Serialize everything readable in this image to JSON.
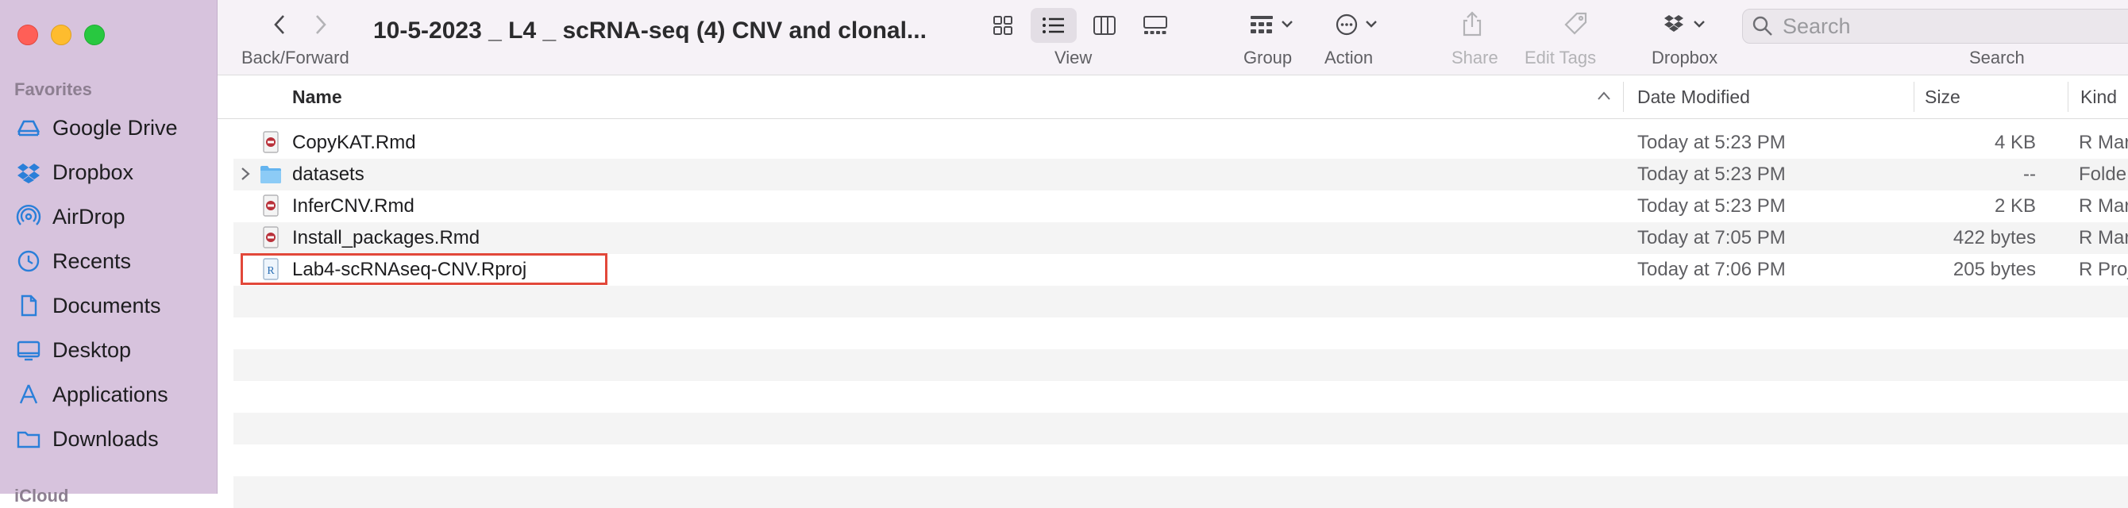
{
  "window": {
    "title": "10-5-2023 _ L4 _ scRNA-seq (4) CNV and clonal...",
    "back_forward_label": "Back/Forward"
  },
  "toolbar": {
    "view_label": "View",
    "group_label": "Group",
    "action_label": "Action",
    "share_label": "Share",
    "edit_tags_label": "Edit Tags",
    "dropbox_label": "Dropbox",
    "search_label": "Search",
    "search_placeholder": "Search",
    "active_view": "list"
  },
  "sidebar": {
    "favorites_header": "Favorites",
    "icloud_header": "iCloud",
    "items": [
      {
        "label": "Google Drive",
        "icon": "google-drive-icon"
      },
      {
        "label": "Dropbox",
        "icon": "dropbox-icon"
      },
      {
        "label": "AirDrop",
        "icon": "airdrop-icon"
      },
      {
        "label": "Recents",
        "icon": "clock-icon"
      },
      {
        "label": "Documents",
        "icon": "document-icon"
      },
      {
        "label": "Desktop",
        "icon": "desktop-icon"
      },
      {
        "label": "Applications",
        "icon": "applications-icon"
      },
      {
        "label": "Downloads",
        "icon": "downloads-icon"
      }
    ]
  },
  "columns": {
    "name": "Name",
    "date_modified": "Date Modified",
    "size": "Size",
    "kind": "Kind"
  },
  "files": [
    {
      "name": "CopyKAT.Rmd",
      "date": "Today at 5:23 PM",
      "size": "4 KB",
      "kind": "R Mar",
      "icon": "rmd-file-icon"
    },
    {
      "name": "datasets",
      "date": "Today at 5:23 PM",
      "size": "--",
      "kind": "Folde",
      "icon": "folder-icon"
    },
    {
      "name": "InferCNV.Rmd",
      "date": "Today at 5:23 PM",
      "size": "2 KB",
      "kind": "R Mar",
      "icon": "rmd-file-icon"
    },
    {
      "name": "Install_packages.Rmd",
      "date": "Today at 7:05 PM",
      "size": "422 bytes",
      "kind": "R Mar",
      "icon": "rmd-file-icon"
    },
    {
      "name": "Lab4-scRNAseq-CNV.Rproj",
      "date": "Today at 7:06 PM",
      "size": "205 bytes",
      "kind": "R Proj",
      "icon": "rproj-file-icon"
    }
  ],
  "colors": {
    "sidebar_bg": "#d7c3dd",
    "toolbar_bg": "#f6f2f7",
    "highlight": "#e2483a",
    "accent": "#1a73e8"
  }
}
